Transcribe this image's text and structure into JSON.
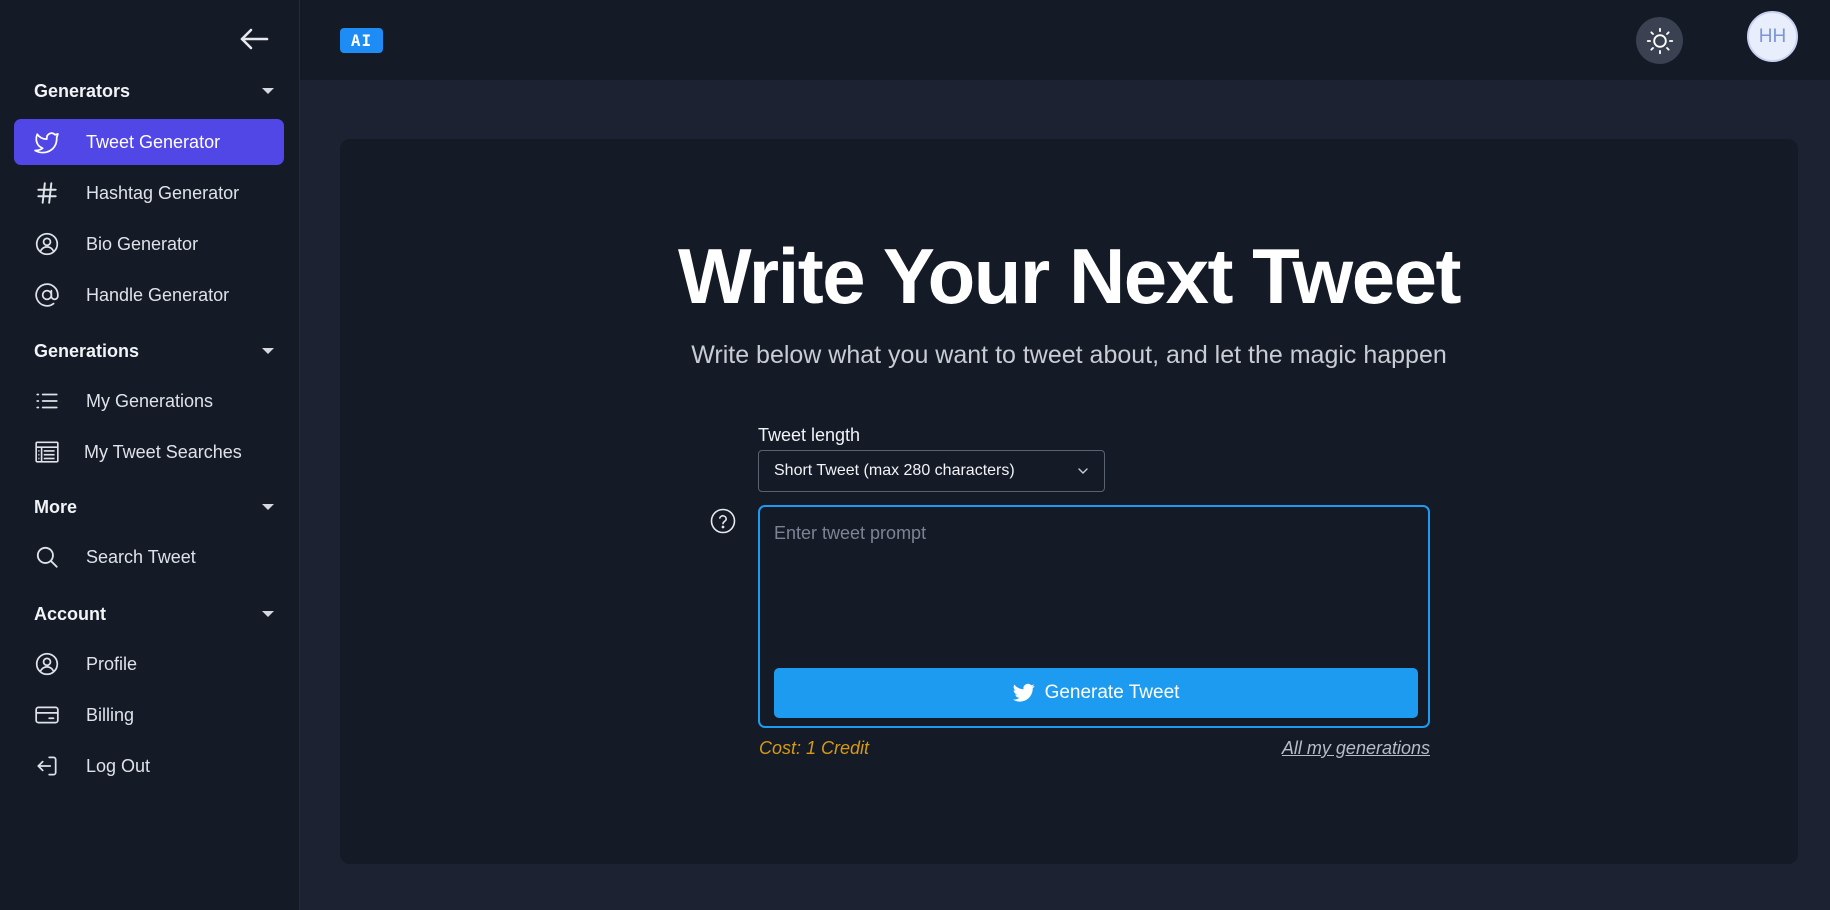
{
  "sidebar": {
    "sections": [
      {
        "title": "Generators",
        "items": [
          {
            "label": "Tweet Generator",
            "icon": "twitter-bird-icon",
            "active": true
          },
          {
            "label": "Hashtag Generator",
            "icon": "hashtag-icon"
          },
          {
            "label": "Bio Generator",
            "icon": "user-circle-icon"
          },
          {
            "label": "Handle Generator",
            "icon": "at-sign-icon"
          }
        ]
      },
      {
        "title": "Generations",
        "items": [
          {
            "label": "My Generations",
            "icon": "list-icon"
          },
          {
            "label": "My Tweet Searches",
            "icon": "table-icon"
          }
        ]
      },
      {
        "title": "More",
        "items": [
          {
            "label": "Search Tweet",
            "icon": "search-icon"
          }
        ]
      },
      {
        "title": "Account",
        "items": [
          {
            "label": "Profile",
            "icon": "user-circle-icon"
          },
          {
            "label": "Billing",
            "icon": "credit-card-icon"
          },
          {
            "label": "Log Out",
            "icon": "logout-icon"
          }
        ]
      }
    ]
  },
  "topbar": {
    "badge": "AI",
    "avatar_initials": "HH"
  },
  "main": {
    "title": "Write Your Next Tweet",
    "subtitle": "Write below what you want to tweet about, and let the magic happen",
    "length_label": "Tweet length",
    "length_selected": "Short Tweet (max 280 characters)",
    "prompt_placeholder": "Enter tweet prompt",
    "prompt_value": "",
    "generate_label": "Generate Tweet",
    "cost": "Cost: 1 Credit",
    "all_generations": "All my generations"
  },
  "colors": {
    "accent_active": "#5146e6",
    "twitter_blue": "#1d9bf0",
    "cost_color": "#d69a14"
  }
}
